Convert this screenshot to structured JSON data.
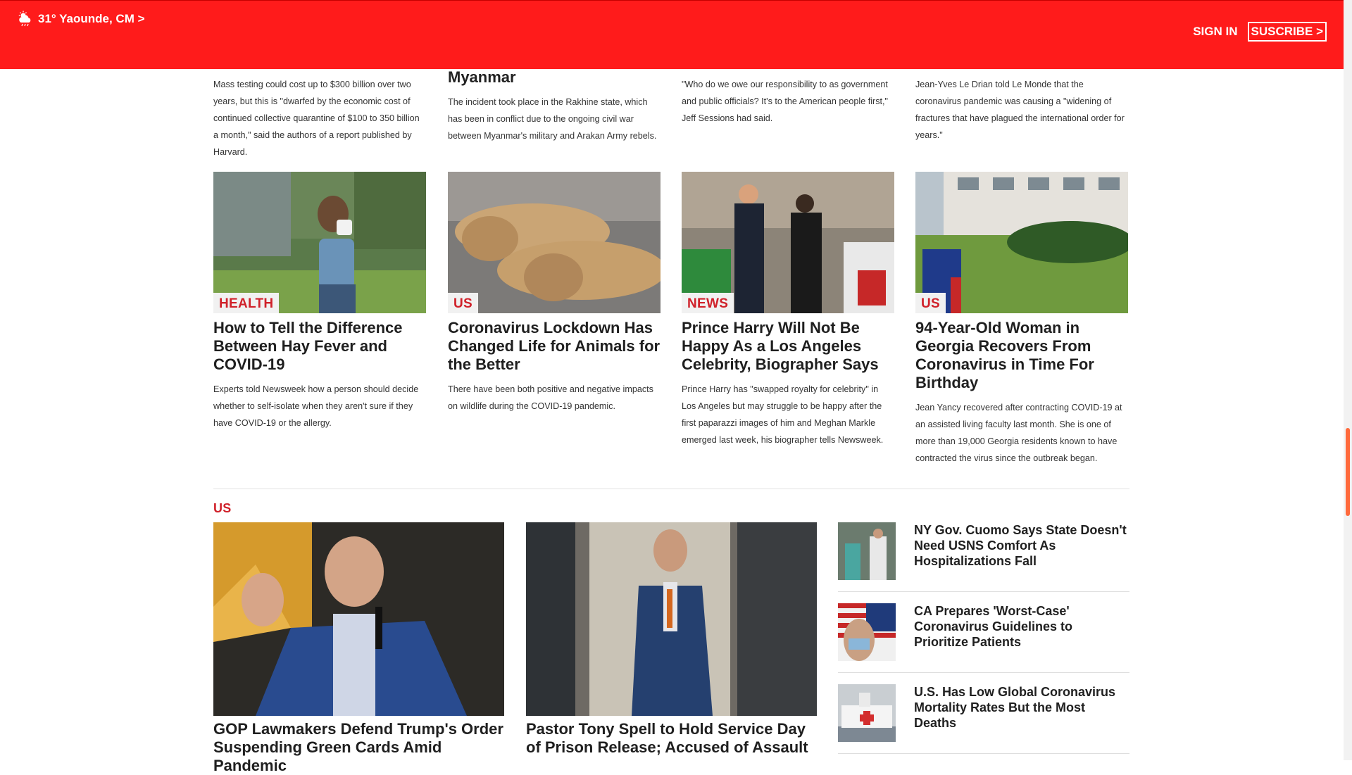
{
  "header": {
    "weather": "31° Yaounde, CM >",
    "sign_in": "SIGN IN",
    "subscribe": "SUSCRIBE >"
  },
  "top_row": [
    {
      "title": "",
      "desc": "Mass testing could cost up to $300 billion over two years, but this is \"dwarfed by the economic cost of continued collective quarantine of $100 to 350 billion a month,\" said the authors of a report published by Harvard."
    },
    {
      "title": "Myanmar",
      "desc": "The incident took place in the Rakhine state, which has been in conflict due to the ongoing civil war between Myanmar's military and Arakan Army rebels."
    },
    {
      "title": "",
      "desc": "\"Who do we owe our responsibility to as government and public officials? It's to the American people first,\" Jeff Sessions had said."
    },
    {
      "title": "",
      "desc": "Jean-Yves Le Drian told Le Monde that the coronavirus pandemic was causing a \"widening of fractures that have plagued the international order for years.\""
    }
  ],
  "cards": [
    {
      "label": "HEALTH",
      "title": "How to Tell the Difference Between Hay Fever and COVID-19",
      "desc": "Experts told Newsweek how a person should decide whether to self-isolate when they aren't sure if they have COVID-19 or the allergy."
    },
    {
      "label": "US",
      "title": "Coronavirus Lockdown Has Changed Life for Animals for the Better",
      "desc": "There have been both positive and negative impacts on wildlife during the COVID-19 pandemic."
    },
    {
      "label": "NEWS",
      "title": "Prince Harry Will Not Be Happy As a Los Angeles Celebrity, Biographer Says",
      "desc": "Prince Harry has \"swapped royalty for celebrity\" in Los Angeles but may struggle to be happy after the first paparazzi images of him and Meghan Markle emerged last week, his biographer tells Newsweek."
    },
    {
      "label": "US",
      "title": "94-Year-Old Woman in Georgia Recovers From Coronavirus in Time For Birthday",
      "desc": "Jean Yancy recovered after contracting COVID-19 at an assisted living faculty last month. She is one of more than 19,000 Georgia residents known to have contracted the virus since the outbreak began."
    }
  ],
  "us_section": {
    "title": "US",
    "big": [
      {
        "title": "GOP Lawmakers Defend Trump's Order Suspending Green Cards Amid Pandemic"
      },
      {
        "title": "Pastor Tony Spell to Hold Service Day of Prison Release; Accused of Assault"
      }
    ],
    "side": [
      {
        "title": "NY Gov. Cuomo Says State Doesn't Need USNS Comfort As Hospitalizations Fall"
      },
      {
        "title": "CA Prepares 'Worst-Case' Coronavirus Guidelines to Prioritize Patients"
      },
      {
        "title": "U.S. Has Low Global Coronavirus Mortality Rates But the Most Deaths"
      }
    ]
  },
  "colors": {
    "brand_red": "#ff1b1b",
    "label_red": "#d0212a"
  }
}
